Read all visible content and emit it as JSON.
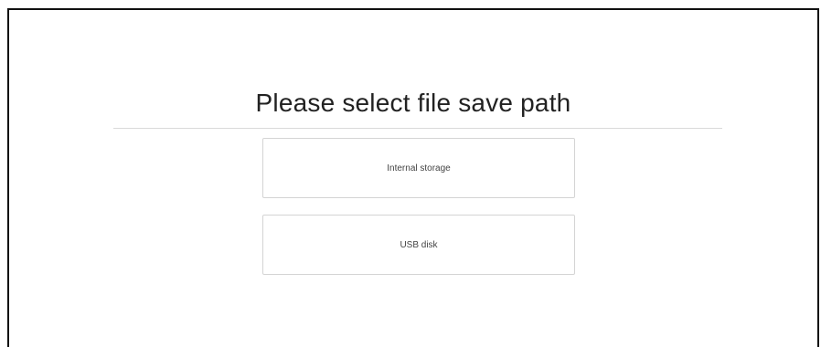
{
  "dialog": {
    "title": "Please select file save path",
    "options": [
      {
        "label": "Internal storage"
      },
      {
        "label": "USB disk"
      }
    ]
  },
  "colors": {
    "border": "#111111",
    "divider": "#d9d9d9",
    "option_border": "#d4d4d4",
    "text": "#222222"
  }
}
